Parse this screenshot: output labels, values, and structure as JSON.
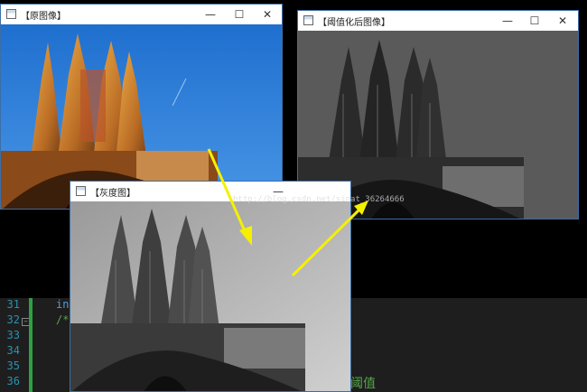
{
  "windows": {
    "original": {
      "title": "【原图像】",
      "minimize": "—",
      "maximize": "☐",
      "close": "✕"
    },
    "threshold": {
      "title": "【阈值化后图像】",
      "minimize": "—",
      "maximize": "☐",
      "close": "✕"
    },
    "gray": {
      "title": "【灰度图】",
      "minimize": "—"
    }
  },
  "editor": {
    "lines": [
      {
        "num": "31",
        "code": "in"
      },
      {
        "num": "32",
        "code": "/*"
      },
      {
        "num": "33",
        "code": ""
      },
      {
        "num": "34",
        "code": ""
      },
      {
        "num": "35",
        "code": ""
      },
      {
        "num": "36",
        "code": "阈值"
      }
    ],
    "fold_marker": "−"
  },
  "watermark": "http://blog.csdn.net/sinat_36264666",
  "colors": {
    "sky_blue": "#2f7fd6",
    "arrow_yellow": "#f5f000",
    "editor_bg": "#1e1e1e",
    "line_number": "#2b91af",
    "change_bar": "#2ea043"
  }
}
